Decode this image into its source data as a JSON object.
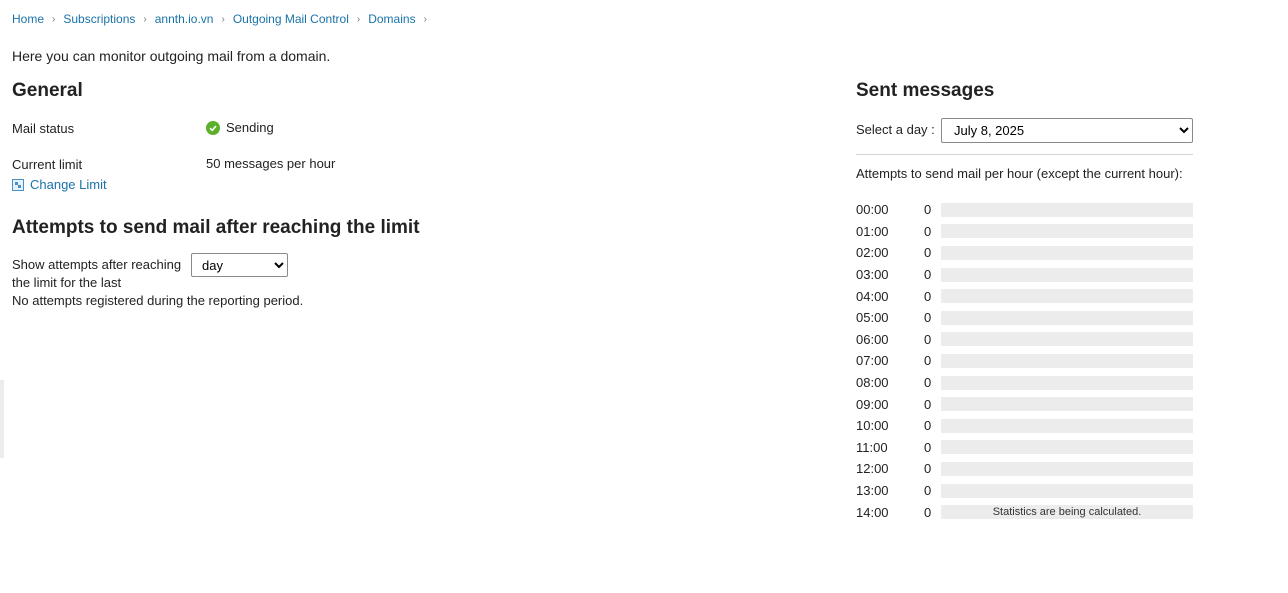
{
  "breadcrumb": [
    "Home",
    "Subscriptions",
    "annth.io.vn",
    "Outgoing Mail Control",
    "Domains"
  ],
  "intro": "Here you can monitor outgoing mail from a domain.",
  "general": {
    "title": "General",
    "mail_status_label": "Mail status",
    "mail_status_value": "Sending",
    "current_limit_label": "Current limit",
    "current_limit_value": "50 messages per hour",
    "change_limit_label": "Change Limit"
  },
  "attempts": {
    "title": "Attempts to send mail after reaching the limit",
    "show_label": "Show attempts after reaching the limit for the last",
    "period_selected": "day",
    "period_options": [
      "day"
    ],
    "no_attempts": "No attempts registered during the reporting period."
  },
  "sent": {
    "title": "Sent messages",
    "select_day_label": "Select a day :",
    "selected_day": "July 8, 2025",
    "day_options": [
      "July 8, 2025"
    ],
    "per_hour_label": "Attempts to send mail per hour (except the current hour):",
    "rows": [
      {
        "hour": "00:00",
        "count": "0",
        "fill": 0,
        "note": ""
      },
      {
        "hour": "01:00",
        "count": "0",
        "fill": 0,
        "note": ""
      },
      {
        "hour": "02:00",
        "count": "0",
        "fill": 0,
        "note": ""
      },
      {
        "hour": "03:00",
        "count": "0",
        "fill": 0,
        "note": ""
      },
      {
        "hour": "04:00",
        "count": "0",
        "fill": 0,
        "note": ""
      },
      {
        "hour": "05:00",
        "count": "0",
        "fill": 0,
        "note": ""
      },
      {
        "hour": "06:00",
        "count": "0",
        "fill": 0,
        "note": ""
      },
      {
        "hour": "07:00",
        "count": "0",
        "fill": 0,
        "note": ""
      },
      {
        "hour": "08:00",
        "count": "0",
        "fill": 0,
        "note": ""
      },
      {
        "hour": "09:00",
        "count": "0",
        "fill": 0,
        "note": ""
      },
      {
        "hour": "10:00",
        "count": "0",
        "fill": 0,
        "note": ""
      },
      {
        "hour": "11:00",
        "count": "0",
        "fill": 0,
        "note": ""
      },
      {
        "hour": "12:00",
        "count": "0",
        "fill": 0,
        "note": ""
      },
      {
        "hour": "13:00",
        "count": "0",
        "fill": 0,
        "note": ""
      },
      {
        "hour": "14:00",
        "count": "0",
        "fill": 0,
        "note": "Statistics are being calculated."
      }
    ]
  },
  "colors": {
    "link": "#1a73a8",
    "status_ok": "#5bb02a",
    "bar_track": "#ececec"
  },
  "icons": {
    "status": "check-circle-icon",
    "change_limit": "change-limit-icon",
    "breadcrumb_separator": "chevron-right-icon"
  }
}
